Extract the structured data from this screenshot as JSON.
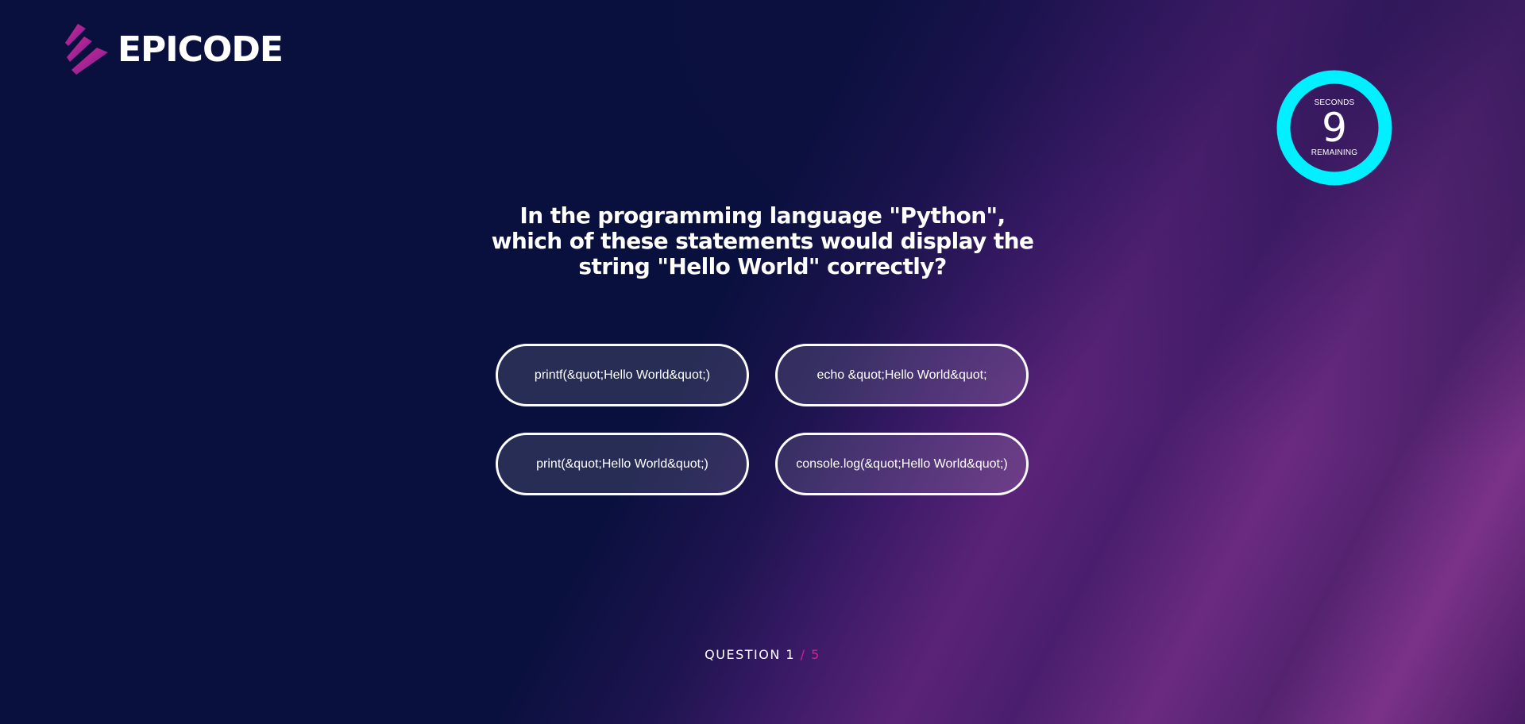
{
  "brand": {
    "name": "EPICODE",
    "logo_icon": "epicode-stripes-icon"
  },
  "timer": {
    "top_label": "SECONDS",
    "value": "9",
    "bottom_label": "REMAINING",
    "ring_color": "#00f0ff"
  },
  "question": {
    "text": "In the programming language \"Python\", which of these statements would display the string \"Hello World\" correctly?"
  },
  "answers": [
    {
      "label": "printf(&quot;Hello World&quot;)"
    },
    {
      "label": "echo &quot;Hello World&quot;"
    },
    {
      "label": "print(&quot;Hello World&quot;)"
    },
    {
      "label": "console.log(&quot;Hello World&quot;)"
    }
  ],
  "progress": {
    "prefix": "QUESTION",
    "current": "1",
    "separator_total": "/ 5"
  },
  "colors": {
    "background": "#0a103e",
    "accent_pink": "#d0258c",
    "timer_ring": "#00f0ff"
  }
}
